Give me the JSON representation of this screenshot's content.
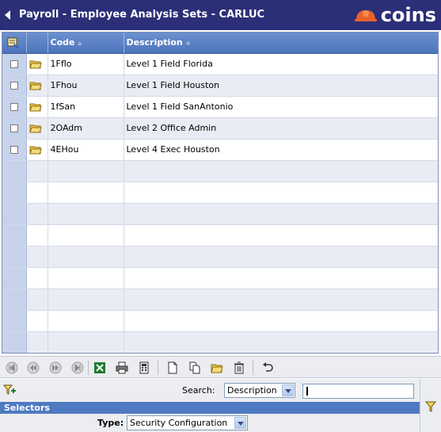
{
  "window": {
    "title": "Payroll - Employee Analysis Sets - CARLUC",
    "brand": "coins",
    "brand_color": "#e8622c",
    "titlebar_color": "#2b2f78"
  },
  "grid": {
    "columns": {
      "code": {
        "label": "Code",
        "sort_icon": "sort-ascending-icon"
      },
      "description": {
        "label": "Description",
        "sort_icon": "sort-indicator-icon"
      }
    },
    "rows": [
      {
        "code": "1Fflo",
        "description": "Level 1 Field Florida"
      },
      {
        "code": "1Fhou",
        "description": "Level 1 Field Houston"
      },
      {
        "code": "1fSan",
        "description": "Level 1 Field SanAntonio"
      },
      {
        "code": "2OAdm",
        "description": "Level 2 Office Admin"
      },
      {
        "code": "4EHou",
        "description": "Level 4 Exec Houston"
      }
    ]
  },
  "toolbar": {
    "buttons": [
      "first-page-icon",
      "previous-page-icon",
      "next-page-icon",
      "last-page-icon",
      "excel-export-icon",
      "print-icon",
      "calculator-icon",
      "new-record-icon",
      "copy-record-icon",
      "open-folder-icon",
      "delete-icon",
      "undo-icon"
    ]
  },
  "search": {
    "label": "Search:",
    "field": "Description",
    "value": ""
  },
  "selectors": {
    "heading": "Selectors",
    "type_label": "Type:",
    "type_value": "Security Configuration"
  }
}
